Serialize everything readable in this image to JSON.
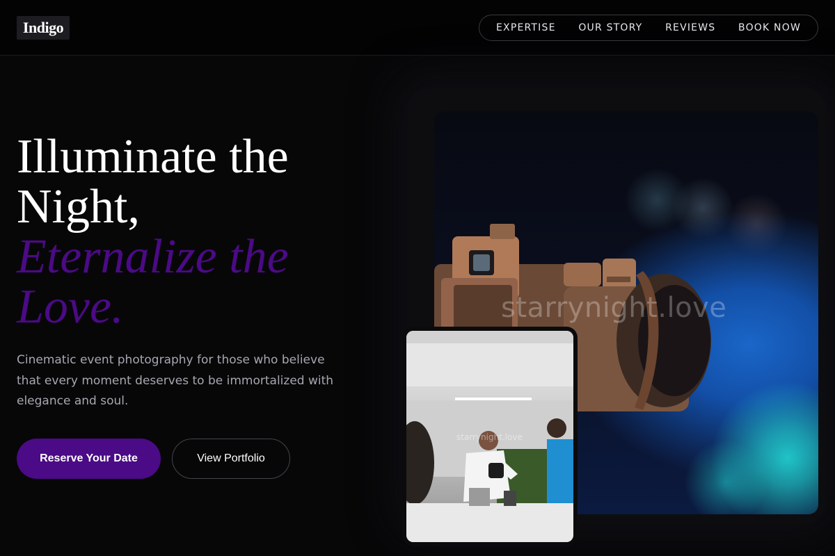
{
  "header": {
    "logo": "Indigo",
    "nav": [
      "EXPERTISE",
      "OUR STORY",
      "REVIEWS",
      "BOOK NOW"
    ]
  },
  "hero": {
    "headline_line1": "Illuminate the Night,",
    "headline_line2": "Eternalize the Love.",
    "subtitle": "Cinematic event photography for those who believe that every moment deserves to be immortalized with elegance and soul.",
    "primary_button": "Reserve Your Date",
    "secondary_button": "View Portfolio"
  },
  "gallery": {
    "main_watermark": "starrynight.love",
    "small_watermark": "starrynight.love"
  },
  "colors": {
    "accent": "#4b0a86",
    "background": "#070708",
    "text_muted": "#a7a7b1"
  }
}
